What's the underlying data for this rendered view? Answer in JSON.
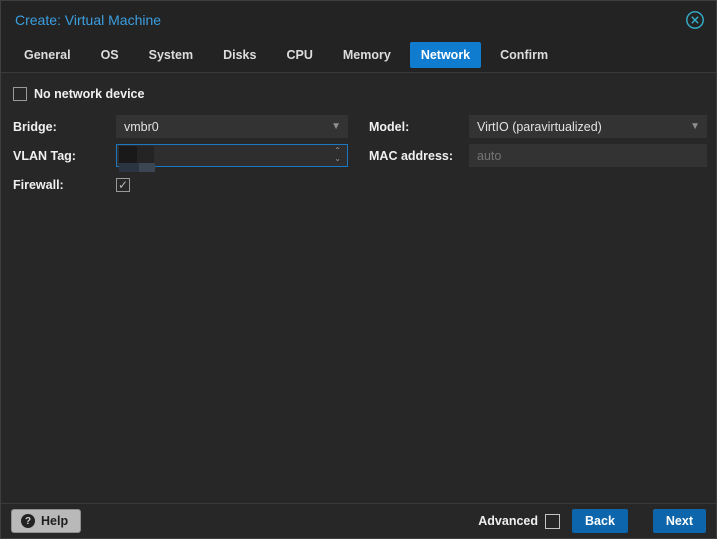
{
  "window": {
    "title": "Create: Virtual Machine"
  },
  "tabs": {
    "active": "Network",
    "items": [
      {
        "label": "General"
      },
      {
        "label": "OS"
      },
      {
        "label": "System"
      },
      {
        "label": "Disks"
      },
      {
        "label": "CPU"
      },
      {
        "label": "Memory"
      },
      {
        "label": "Network"
      },
      {
        "label": "Confirm"
      }
    ]
  },
  "form": {
    "no_network_device": {
      "label": "No network device",
      "checked": false
    },
    "bridge": {
      "label": "Bridge:",
      "value": "vmbr0"
    },
    "vlan_tag": {
      "label": "VLAN Tag:",
      "value": "",
      "redacted": true,
      "focused": true
    },
    "firewall": {
      "label": "Firewall:",
      "checked": true
    },
    "model": {
      "label": "Model:",
      "value": "VirtIO (paravirtualized)"
    },
    "mac_address": {
      "label": "MAC address:",
      "value": "",
      "placeholder": "auto"
    }
  },
  "footer": {
    "help_label": "Help",
    "help_icon_glyph": "?",
    "advanced_label": "Advanced",
    "advanced_checked": false,
    "back_label": "Back",
    "next_label": "Next"
  },
  "colors": {
    "title_blue": "#3b9fe0",
    "active_tab_blue": "#0f7cd0",
    "button_blue": "#0d66ab",
    "focus_border_blue": "#1c77c2",
    "close_icon_teal": "#35b0cf",
    "field_background": "#333333",
    "window_background": "#272727"
  }
}
